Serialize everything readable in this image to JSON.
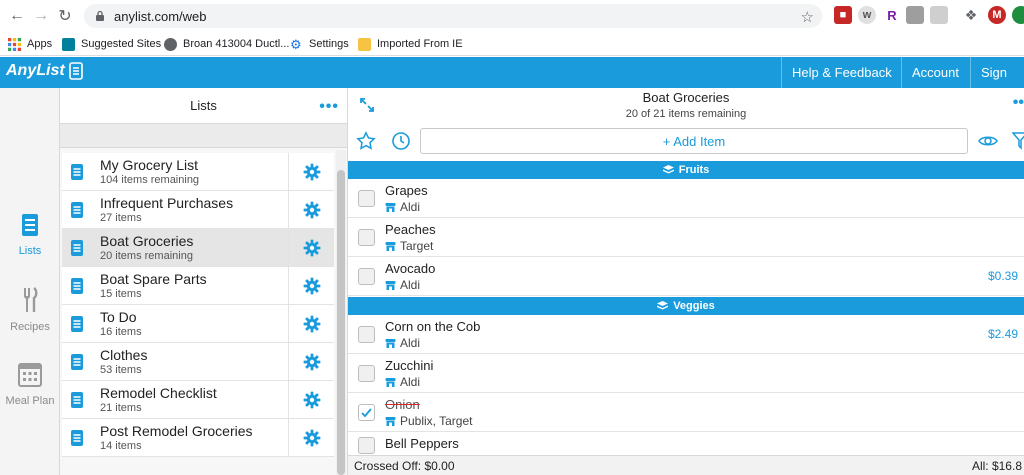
{
  "browser": {
    "url": "anylist.com/web",
    "bookmarks": [
      "Apps",
      "Suggested Sites",
      "Broan 413004 Ductl...",
      "Settings",
      "Imported From IE"
    ],
    "profile_initial": "M",
    "ext_labels": [
      "w",
      "R"
    ]
  },
  "header": {
    "logo": "AnyList",
    "links": [
      "Help & Feedback",
      "Account",
      "Sign Out"
    ]
  },
  "rail": {
    "items": [
      "Lists",
      "Recipes",
      "Meal Plan"
    ]
  },
  "lists_pane": {
    "title": "Lists",
    "more": "•••",
    "lists": [
      {
        "name": "My Grocery List",
        "sub": "104 items remaining"
      },
      {
        "name": "Infrequent Purchases",
        "sub": "27 items"
      },
      {
        "name": "Boat Groceries",
        "sub": "20 items remaining"
      },
      {
        "name": "Boat Spare Parts",
        "sub": "15 items"
      },
      {
        "name": "To Do",
        "sub": "16 items"
      },
      {
        "name": "Clothes",
        "sub": "53 items"
      },
      {
        "name": "Remodel Checklist",
        "sub": "21 items"
      },
      {
        "name": "Post Remodel Groceries",
        "sub": "14 items"
      }
    ]
  },
  "detail": {
    "title": "Boat Groceries",
    "subtitle": "20 of 21 items remaining",
    "more": "••",
    "add_item": "+ Add Item",
    "categories": [
      "Fruits",
      "Veggies"
    ],
    "items": [
      {
        "name": "Grapes",
        "store": "Aldi",
        "price": "",
        "checked": false
      },
      {
        "name": "Peaches",
        "store": "Target",
        "price": "",
        "checked": false
      },
      {
        "name": "Avocado",
        "store": "Aldi",
        "price": "$0.39",
        "checked": false
      },
      {
        "name": "Corn on the Cob",
        "store": "Aldi",
        "price": "$2.49",
        "checked": false
      },
      {
        "name": "Zucchini",
        "store": "Aldi",
        "price": "",
        "checked": false
      },
      {
        "name": "Onion",
        "store": "Publix, Target",
        "price": "",
        "checked": true
      },
      {
        "name": "Bell Peppers",
        "store": "",
        "price": "",
        "checked": false
      }
    ],
    "footer_left": "Crossed Off: $0.00",
    "footer_right": "All: $16.8"
  },
  "colors": {
    "accent": "#1a9bdc",
    "strike": "#d9262b"
  }
}
